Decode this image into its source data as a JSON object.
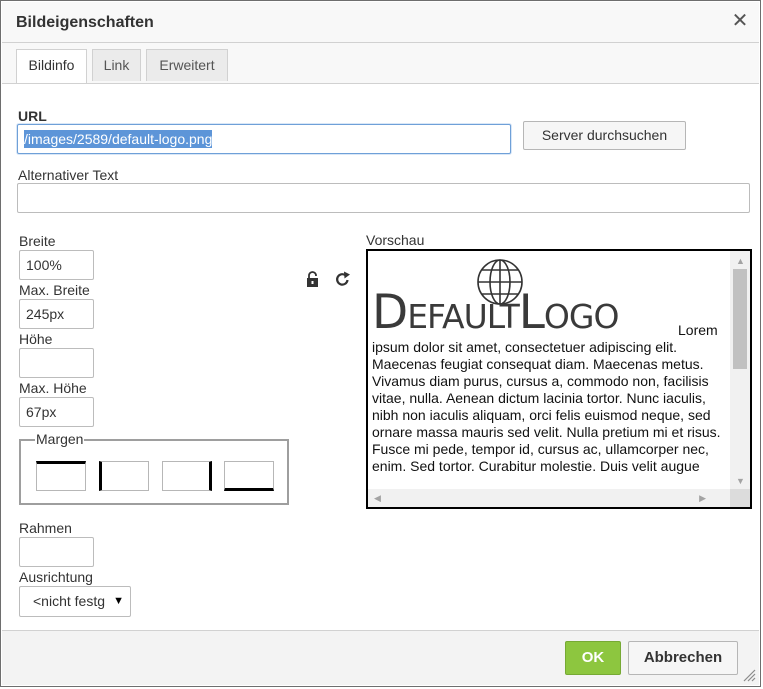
{
  "dialog": {
    "title": "Bildeigenschaften",
    "close_glyph": "✕"
  },
  "tabs": [
    {
      "label": "Bildinfo",
      "active": true
    },
    {
      "label": "Link",
      "active": false
    },
    {
      "label": "Erweitert",
      "active": false
    }
  ],
  "form": {
    "url_label": "URL",
    "url_value": "/images/2589/default-logo.png",
    "browse_button": "Server durchsuchen",
    "alt_label": "Alternativer Text",
    "alt_value": "",
    "width_label": "Breite",
    "width_value": "100%",
    "maxwidth_label": "Max. Breite",
    "maxwidth_value": "245px",
    "height_label": "Höhe",
    "height_value": "",
    "maxheight_label": "Max. Höhe",
    "maxheight_value": "67px",
    "margins_legend": "Margen",
    "border_label": "Rahmen",
    "border_value": "",
    "align_label": "Ausrichtung",
    "align_value": "<nicht festg"
  },
  "preview": {
    "label": "Vorschau",
    "logo_text": "DefaultLogo",
    "text": "Lorem ipsum dolor sit amet, consectetuer adipiscing elit. Maecenas feugiat consequat diam. Maecenas metus. Vivamus diam purus, cursus a, commodo non, facilisis vitae, nulla. Aenean dictum lacinia tortor. Nunc iaculis, nibh non iaculis aliquam, orci felis euismod neque, sed ornare massa mauris sed velit. Nulla pretium mi et risus. Fusce mi pede, tempor id, cursus ac, ullamcorper nec, enim. Sed tortor. Curabitur molestie. Duis velit augue"
  },
  "footer": {
    "ok_label": "OK",
    "cancel_label": "Abbrechen"
  },
  "colors": {
    "ok_green": "#8dc63f",
    "selection_blue": "#5d95d8"
  }
}
